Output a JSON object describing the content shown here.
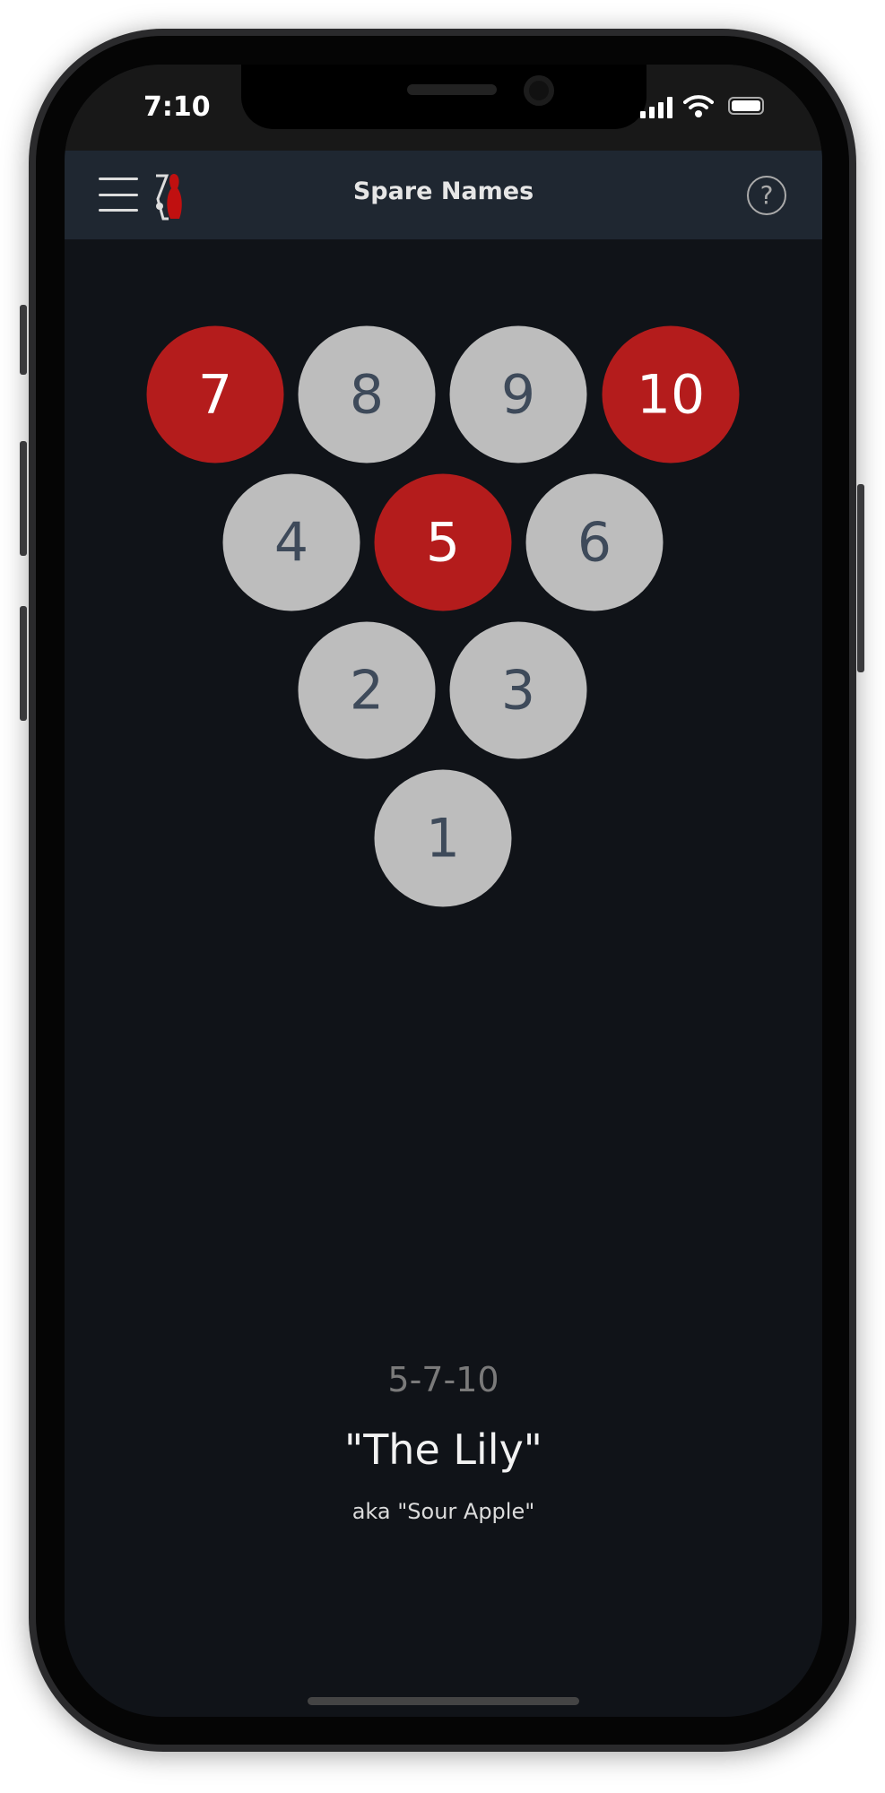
{
  "status_bar": {
    "time": "7:10",
    "icons": [
      "signal-icon",
      "wifi-icon",
      "battery-icon"
    ]
  },
  "header": {
    "title": "Spare Names",
    "menu_icon": "hamburger-menu-icon",
    "logo_icon": "bowling-pin-logo-icon",
    "help_icon": "help-circle-icon"
  },
  "pins": [
    {
      "number": "7",
      "down": false,
      "selected": true
    },
    {
      "number": "8",
      "selected": false
    },
    {
      "number": "9",
      "selected": false
    },
    {
      "number": "10",
      "selected": true
    },
    {
      "number": "4",
      "selected": false
    },
    {
      "number": "5",
      "selected": true
    },
    {
      "number": "6",
      "selected": false
    },
    {
      "number": "2",
      "selected": false
    },
    {
      "number": "3",
      "selected": false
    },
    {
      "number": "1",
      "selected": false
    }
  ],
  "result": {
    "leave": "5-7-10",
    "name": "\"The Lily\"",
    "aka": "aka \"Sour Apple\""
  },
  "colors": {
    "selected_pin": "#b41c1c",
    "standing_pin": "#bdbdbd",
    "header_bg": "#1f2731",
    "background": "#101318"
  }
}
